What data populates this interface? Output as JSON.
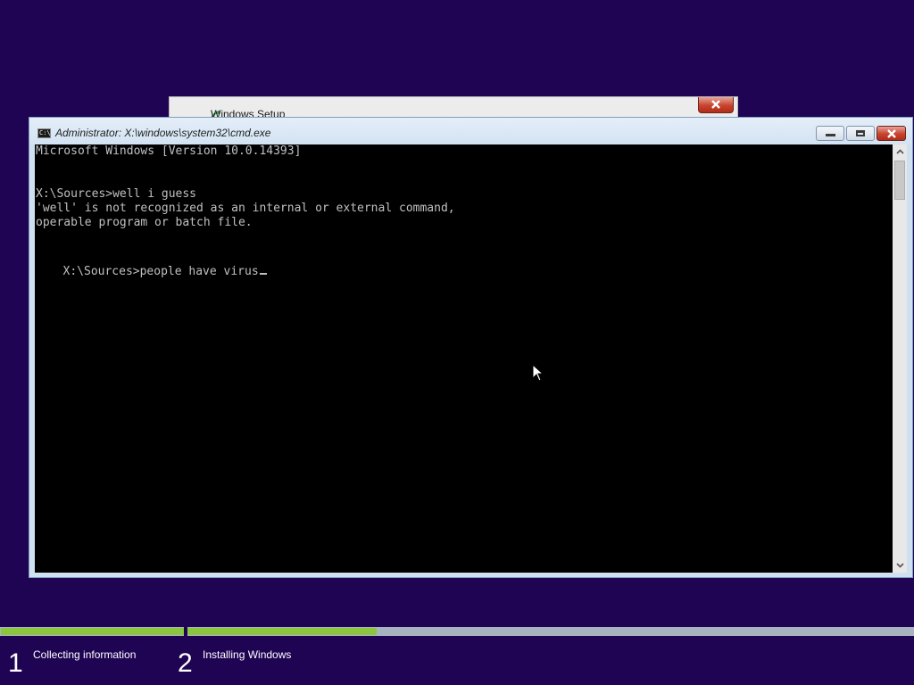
{
  "setup_window": {
    "title": "Windows Setup"
  },
  "cmd_window": {
    "title": "Administrator: X:\\windows\\system32\\cmd.exe",
    "icon_text": "C:\\",
    "controls": {
      "minimize_icon": "minimize-icon",
      "maximize_icon": "maximize-icon",
      "close_icon": "close-icon"
    },
    "console_lines": [
      "Microsoft Windows [Version 10.0.14393]",
      "",
      "",
      "X:\\Sources>well i guess",
      "'well' is not recognized as an internal or external command,",
      "operable program or batch file.",
      "",
      "X:\\Sources>people have virus"
    ]
  },
  "progress": {
    "step1": {
      "number": "1",
      "label": "Collecting information",
      "fill": 1.0
    },
    "step2": {
      "number": "2",
      "label": "Installing Windows",
      "fill": 0.26
    }
  },
  "colors": {
    "desktop": "#200454",
    "progress_fill": "#8cc63f",
    "progress_track": "#a8b3c0",
    "console_bg": "#000000",
    "console_text": "#c0c0c0"
  }
}
